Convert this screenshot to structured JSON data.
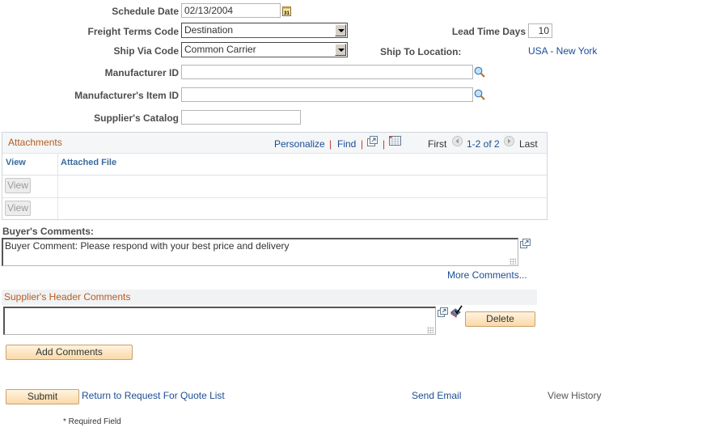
{
  "form": {
    "schedule_date": {
      "label": "Schedule Date",
      "value": "02/13/2004"
    },
    "freight_terms": {
      "label": "Freight Terms Code",
      "value": "Destination"
    },
    "ship_via": {
      "label": "Ship Via Code",
      "value": "Common Carrier"
    },
    "lead_time": {
      "label": "Lead Time Days",
      "value": "10"
    },
    "ship_to": {
      "label": "Ship To Location:",
      "value": "USA - New York"
    },
    "manufacturer_id": {
      "label": "Manufacturer ID",
      "value": ""
    },
    "manufacturer_item_id": {
      "label": "Manufacturer's Item ID",
      "value": ""
    },
    "supplier_catalog": {
      "label": "Supplier's Catalog",
      "value": ""
    }
  },
  "attachments": {
    "title": "Attachments",
    "personalize": "Personalize",
    "find": "Find",
    "separator": "|",
    "first": "First",
    "range": "1-2 of 2",
    "last": "Last",
    "columns": [
      "View",
      "Attached File"
    ],
    "rows": [
      {
        "view_label": "View",
        "file": ""
      },
      {
        "view_label": "View",
        "file": ""
      }
    ]
  },
  "buyer_comments": {
    "label": "Buyer's Comments:",
    "value": "Buyer Comment: Please respond with your best price and delivery",
    "more_link": "More Comments..."
  },
  "supplier_comments": {
    "title": "Supplier's Header Comments",
    "value": "",
    "delete_label": "Delete",
    "add_label": "Add Comments"
  },
  "footer": {
    "submit_label": "Submit",
    "return_link": "Return to Request For Quote List",
    "send_email": "Send Email",
    "view_history": "View History",
    "required_note": "* Required Field"
  },
  "colors": {
    "link": "#1b4d93",
    "section_title": "#b75b1d",
    "button_bg": "#fbd9a8"
  }
}
